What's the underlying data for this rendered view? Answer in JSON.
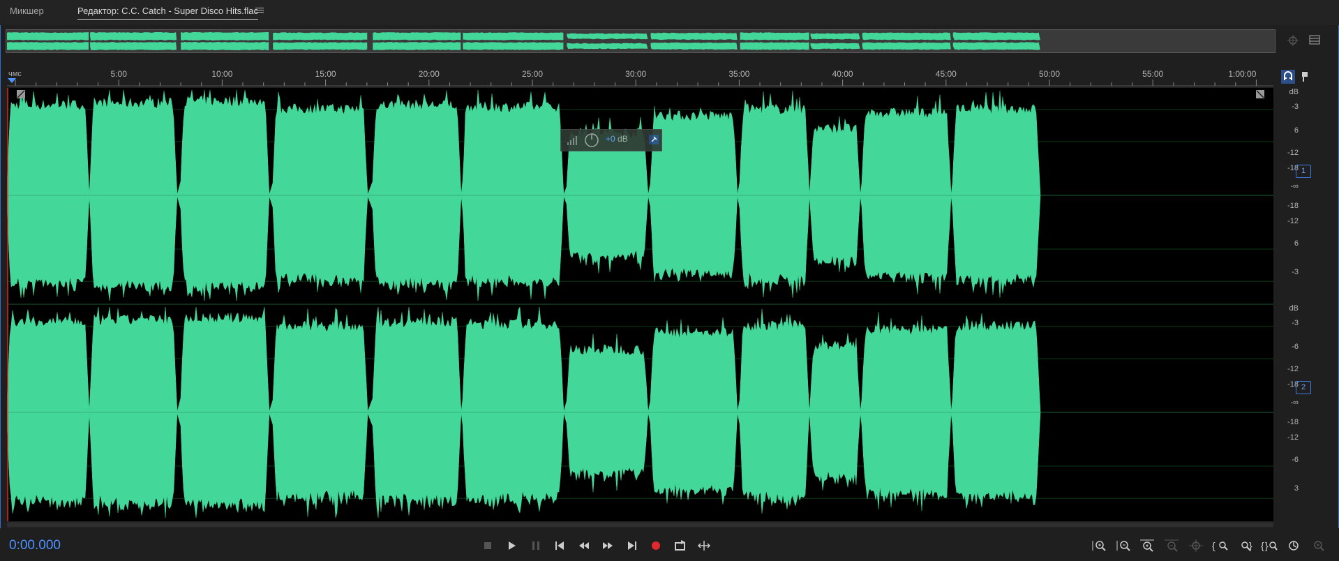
{
  "tabs": {
    "mixer_label": "Микшер",
    "editor_label": "Редактор: C.C. Catch - Super Disco Hits.flac"
  },
  "ruler": {
    "unit_label": "чмс",
    "ticks": [
      "5:00",
      "10:00",
      "15:00",
      "20:00",
      "25:00",
      "30:00",
      "35:00",
      "40:00",
      "45:00",
      "50:00",
      "55:00",
      "1:00:00"
    ]
  },
  "hud": {
    "volume_value": "+0",
    "volume_unit": "dB"
  },
  "channels": [
    {
      "badge": "1",
      "db_labels": [
        "dB",
        "-3",
        "6",
        "-12",
        "-18",
        "-∞",
        "-18",
        "-12",
        "6",
        "-3"
      ]
    },
    {
      "badge": "2",
      "db_labels": [
        "dB",
        "-3",
        "-6",
        "-12",
        "-18",
        "-∞",
        "-18",
        "-12",
        "-6",
        "3"
      ]
    }
  ],
  "transport": {
    "time": "0:00.000",
    "buttons": [
      "stop-icon",
      "play-icon",
      "pause-icon",
      "skip-to-start-icon",
      "rewind-icon",
      "fast-forward-icon",
      "skip-to-end-icon",
      "record-icon",
      "loop-playback-icon",
      "skip-selection-icon"
    ]
  },
  "zoom_tools": [
    "zoom-in-amplitude-icon",
    "zoom-out-amplitude-icon",
    "zoom-in-time-icon",
    "zoom-out-time-icon",
    "zoom-full-icon",
    "zoom-in-selection-icon",
    "zoom-out-full-icon",
    "zoom-left-icon",
    "zoom-right-icon",
    "zoom-reset-icon",
    "zoom-settings-icon"
  ],
  "colors": {
    "waveform": "#43d89a",
    "accent": "#2d6fd6",
    "time_text": "#4e93ff",
    "record": "#e0282e",
    "background": "#1f1f1f"
  }
}
